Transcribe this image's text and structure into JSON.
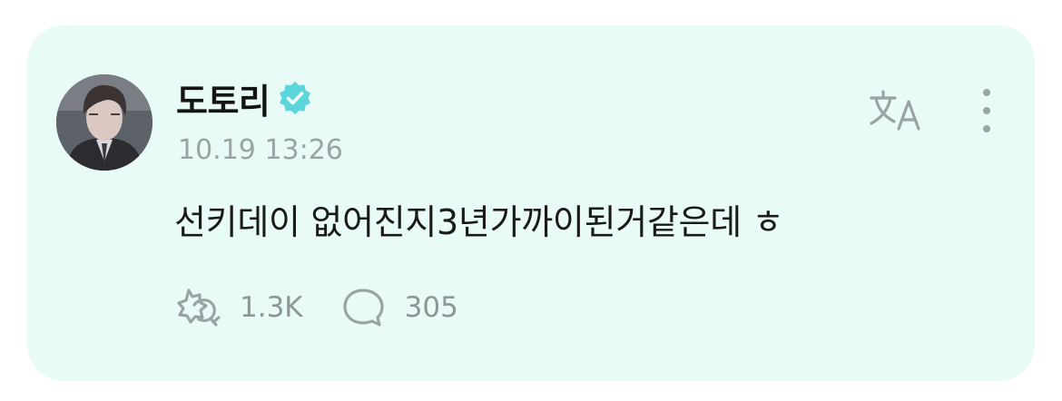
{
  "post": {
    "author": "도토리",
    "verified": true,
    "timestamp": "10.19 13:26",
    "text": "선키데이 없어진지3년가까이된거같은데 ㅎ",
    "reactions_count": "1.3K",
    "comments_count": "305"
  },
  "icons": {
    "verified": "verified-check-icon",
    "translate": "translate-icon",
    "more": "more-vertical-icon",
    "reaction": "reaction-icon",
    "comment": "comment-bubble-icon"
  },
  "colors": {
    "card_background": "#e9fbf6",
    "verified": "#5cd6dc",
    "muted": "#9aa4a6"
  }
}
